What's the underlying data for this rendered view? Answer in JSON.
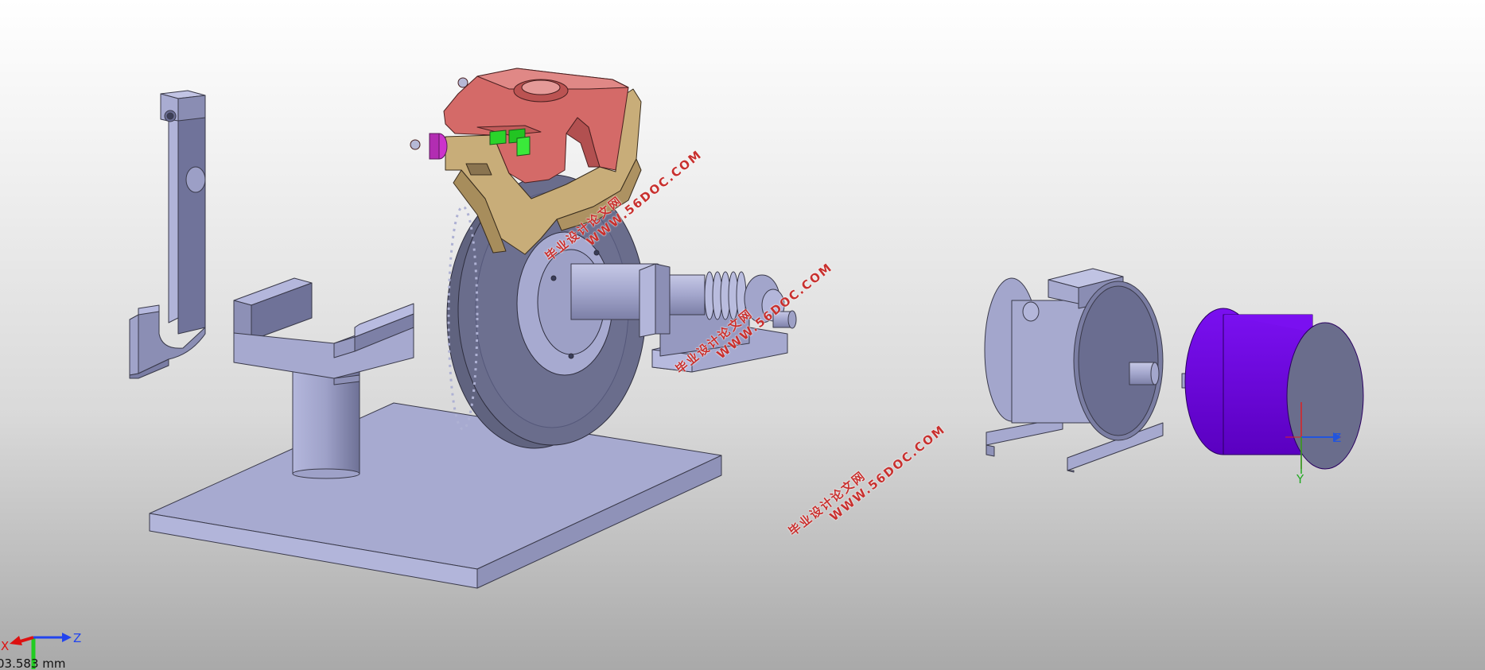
{
  "viewport": {
    "background_top": "#ffffff",
    "background_bottom": "#a9a9a9"
  },
  "model": {
    "part_color": "#a3a6cc",
    "caliper_color": "#d96a6a",
    "bracket_color": "#c9ad7a",
    "pad_color": "#22d422",
    "piston_color": "#cc33cc",
    "motor_color": "#6b00dd"
  },
  "watermarks": [
    {
      "line1": "毕业设计论文网",
      "line2": "WWW.56DOC.COM"
    },
    {
      "line1": "毕业设计论文网",
      "line2": "WWW.56DOC.COM"
    },
    {
      "line1": "毕业设计论文网",
      "line2": "WWW.56DOC.COM"
    }
  ],
  "triad": {
    "x_label": "X",
    "y_label": "Y",
    "z_label": "Z",
    "scale_text": "03.583 mm"
  },
  "model_triad": {
    "y_label": "Y",
    "z_label": "Z"
  },
  "icons": [
    "coordinate-triad-icon"
  ]
}
